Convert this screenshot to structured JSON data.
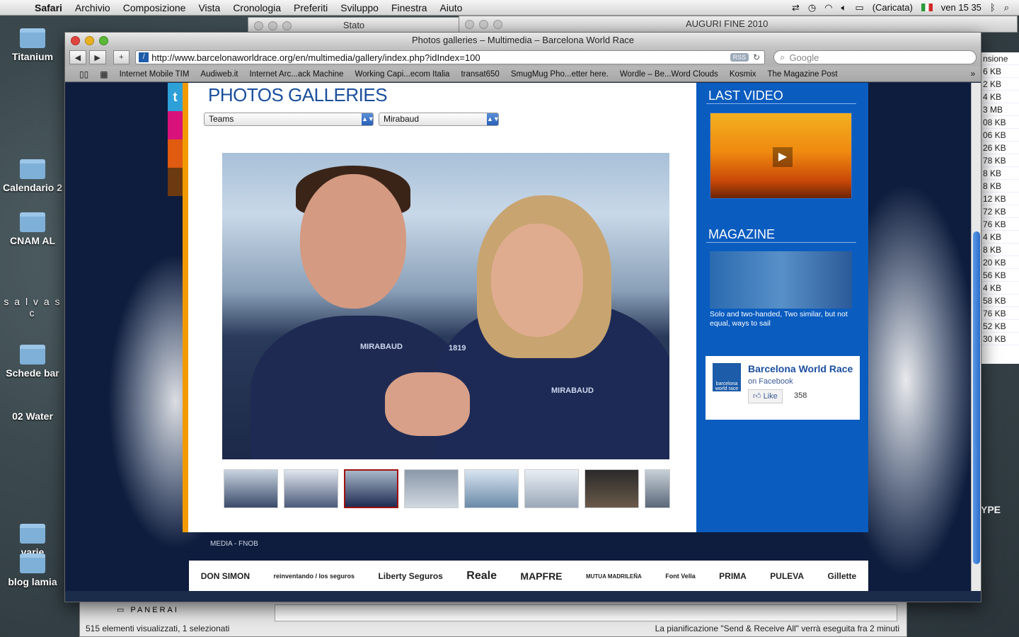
{
  "menubar": {
    "app": "Safari",
    "items": [
      "Archivio",
      "Composizione",
      "Vista",
      "Cronologia",
      "Preferiti",
      "Sviluppo",
      "Finestra",
      "Aiuto"
    ],
    "battery": "(Caricata)",
    "clock": "ven 15 35"
  },
  "desktop": {
    "icons": [
      "Titanium",
      "Calendario 2",
      "CNAM AL",
      "s a l v a s c",
      "Schede bar",
      "02 Water",
      "varie",
      "blog lamia"
    ],
    "side_text": "YPE"
  },
  "bg_windows": {
    "stato_title": "Stato",
    "auguri_title": "AUGURI FINE 2010",
    "right_list_header": "nsione",
    "right_list": [
      "6 KB",
      "2 KB",
      "4 KB",
      "3 MB",
      "08 KB",
      "06 KB",
      "26 KB",
      "78 KB",
      "8 KB",
      "8 KB",
      "12 KB",
      "72 KB",
      "76 KB",
      "4 KB",
      "8 KB",
      "20 KB",
      "56 KB",
      "4 KB",
      "58 KB",
      "76 KB",
      "52 KB",
      "30 KB"
    ]
  },
  "mail": {
    "folder": "PANERAI",
    "status_left": "515 elementi visualizzati, 1 selezionati",
    "status_right": "La pianificazione \"Send & Receive All\" verrà eseguita fra 2 minuti"
  },
  "safari": {
    "title": "Photos galleries – Multimedia – Barcelona World Race",
    "url": "http://www.barcelonaworldrace.org/en/multimedia/gallery/index.php?idIndex=100",
    "rss": "RSS",
    "search_placeholder": "Google",
    "bookmarks": [
      "Internet Mobile TIM",
      "Audiweb.it",
      "Internet Arc...ack Machine",
      "Working Capi...ecom Italia",
      "transat650",
      "SmugMug Pho...etter here.",
      "Wordle – Be...Word Clouds",
      "Kosmix",
      "The Magazine Post"
    ]
  },
  "page": {
    "gallery_title": "PHOTOS GALLERIES",
    "filter_category": "Teams",
    "filter_team": "Mirabaud",
    "photo_logo_1": "MIRABAUD",
    "photo_logo_2": "1819",
    "photo_logo_3": "MIRABAUD",
    "thumb_count": 8,
    "selected_thumb": 3,
    "footer_links": "MEDIA  -  FNOB",
    "sponsors": [
      "DON SIMON",
      "reinventando / los seguros",
      "Liberty Seguros",
      "Reale",
      "MAPFRE",
      "MUTUA MADRILEÑA",
      "Font Vella",
      "PRIMA",
      "PULEVA",
      "Gillette"
    ]
  },
  "sidebar": {
    "last_video_title": "LAST VIDEO",
    "magazine_title": "MAGAZINE",
    "magazine_caption": "Solo and two-handed, Two similar, but not equal, ways to sail",
    "facebook": {
      "logo_text": "barcelona world race",
      "name": "Barcelona World Race",
      "on": "on Facebook",
      "like": "Like",
      "count": "358"
    }
  }
}
